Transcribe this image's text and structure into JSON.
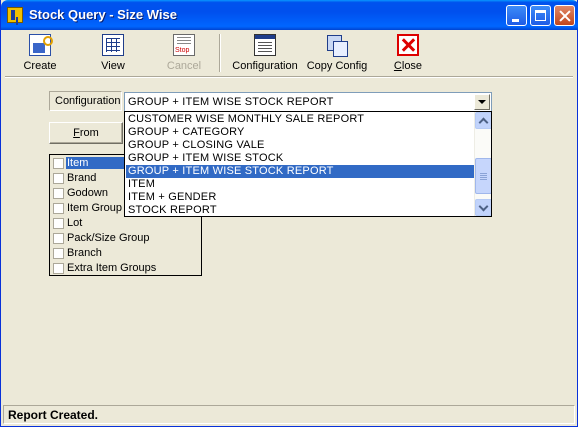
{
  "window": {
    "title": "Stock Query - Size Wise"
  },
  "toolbar": {
    "items": [
      {
        "label_pre": "",
        "label_key": "",
        "label_post": "Create",
        "icon": "create-icon",
        "enabled": true
      },
      {
        "label_pre": "",
        "label_key": "",
        "label_post": "View",
        "icon": "view-icon",
        "enabled": true
      },
      {
        "label_pre": "",
        "label_key": "",
        "label_post": "Cancel",
        "icon": "stop-icon",
        "enabled": false
      },
      {
        "label_pre": "",
        "label_key": "",
        "label_post": "Configuration",
        "icon": "configuration-icon",
        "enabled": true
      },
      {
        "label_pre": "",
        "label_key": "",
        "label_post": "Copy Config",
        "icon": "copy-config-icon",
        "enabled": true
      },
      {
        "label_pre": "",
        "label_key": "C",
        "label_post": "lose",
        "icon": "close-icon",
        "enabled": true
      }
    ]
  },
  "config": {
    "label": "Configuration",
    "selected_value": "GROUP + ITEM WISE STOCK REPORT",
    "options": [
      "CUSTOMER WISE MONTHLY SALE REPORT",
      "GROUP + CATEGORY",
      "GROUP + CLOSING VALE",
      "GROUP + ITEM WISE STOCK",
      "GROUP + ITEM WISE STOCK REPORT",
      "ITEM",
      "ITEM + GENDER",
      "STOCK REPORT"
    ],
    "highlighted_index": 4
  },
  "from_button": {
    "label_key": "F",
    "label_post": "rom"
  },
  "checklist": {
    "items": [
      {
        "label": "Item",
        "checked": false,
        "selected": true
      },
      {
        "label": "Brand",
        "checked": false,
        "selected": false
      },
      {
        "label": "Godown",
        "checked": false,
        "selected": false
      },
      {
        "label": "Item Group",
        "checked": false,
        "selected": false
      },
      {
        "label": "Lot",
        "checked": false,
        "selected": false
      },
      {
        "label": "Pack/Size Group",
        "checked": false,
        "selected": false
      },
      {
        "label": "Branch",
        "checked": false,
        "selected": false
      },
      {
        "label": "Extra Item Groups",
        "checked": false,
        "selected": false
      }
    ]
  },
  "statusbar": {
    "text": "Report Created."
  },
  "colors": {
    "titlebar": "#0058ee",
    "selection": "#316ac5",
    "window_bg": "#ece9d8",
    "disabled_text": "#aca899"
  }
}
